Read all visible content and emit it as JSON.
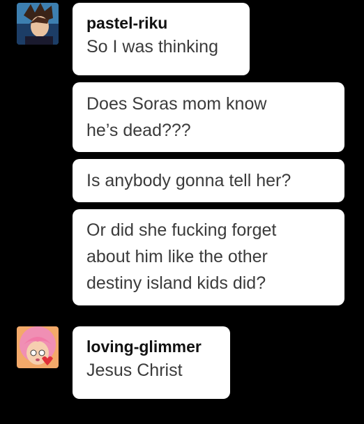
{
  "conversation": [
    {
      "user": "pastel-riku",
      "avatar_icon": "riku-avatar-icon",
      "messages": [
        "So I was thinking",
        "Does Soras mom know\nhe’s dead???",
        "Is anybody gonna tell her?",
        "Or did she fucking forget\nabout him like the other\ndestiny island kids did?"
      ]
    },
    {
      "user": "loving-glimmer",
      "avatar_icon": "glimmer-avatar-icon",
      "messages": [
        "Jesus Christ"
      ]
    }
  ],
  "colors": {
    "background": "#000000",
    "bubble": "#ffffff",
    "text": "#3b3b3b"
  }
}
